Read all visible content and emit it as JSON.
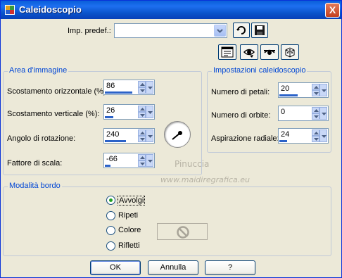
{
  "window": {
    "title": "Caleidoscopio",
    "close_label": "X"
  },
  "preset": {
    "label": "Imp. predef.:",
    "value": ""
  },
  "toolbar": {
    "icons": [
      "preset-list-icon",
      "show-original-icon",
      "hide-original-icon",
      "randomize-icon"
    ]
  },
  "area": {
    "title": "Area d'immagine",
    "fields": [
      {
        "label": "Scostamento orizzontale (%):",
        "value": "86",
        "fill": 0.86
      },
      {
        "label": "Scostamento verticale (%):",
        "value": "26",
        "fill": 0.26
      },
      {
        "label": "Angolo di rotazione:",
        "value": "240",
        "fill": 0.67
      },
      {
        "label": "Fattore di scala:",
        "value": "-66",
        "fill": 0.17
      }
    ]
  },
  "settings": {
    "title": "Impostazioni caleidoscopio",
    "fields": [
      {
        "label": "Numero di petali:",
        "value": "20",
        "fill": 0.6
      },
      {
        "label": "Numero di orbite:",
        "value": "0",
        "fill": 0.0
      },
      {
        "label": "Aspirazione radiale:",
        "value": "24",
        "fill": 0.24
      }
    ]
  },
  "watermark": {
    "line1": "Pinuccia",
    "line2": "www.maidiregrafica.eu"
  },
  "border_mode": {
    "title": "Modalità bordo",
    "options": [
      {
        "label": "Avvolgi",
        "checked": true
      },
      {
        "label": "Ripeti",
        "checked": false
      },
      {
        "label": "Colore",
        "checked": false
      },
      {
        "label": "Rifletti",
        "checked": false
      }
    ]
  },
  "buttons": {
    "ok": "OK",
    "cancel": "Annulla",
    "help": "?"
  },
  "colors": {
    "title_bar": "#0a5fd8",
    "dialog_bg": "#ece9d8",
    "group_title": "#0046d5",
    "value_bar": "#2b62c8"
  }
}
